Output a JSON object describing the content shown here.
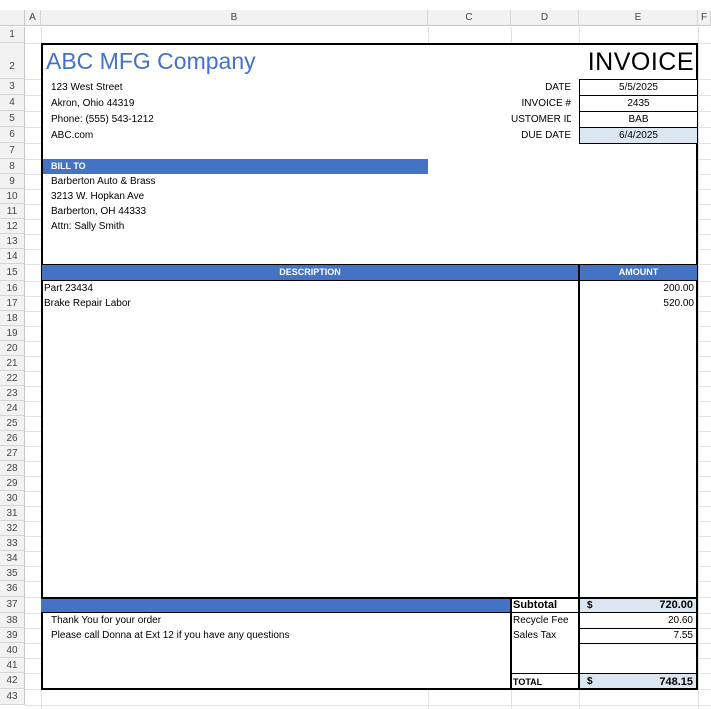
{
  "columns": [
    "A",
    "B",
    "C",
    "D",
    "E",
    "F"
  ],
  "rows": [
    "1",
    "2",
    "3",
    "4",
    "5",
    "6",
    "7",
    "8",
    "9",
    "10",
    "11",
    "12",
    "13",
    "14",
    "15",
    "16",
    "17",
    "18",
    "19",
    "20",
    "21",
    "22",
    "23",
    "24",
    "25",
    "26",
    "27",
    "28",
    "29",
    "30",
    "31",
    "32",
    "33",
    "34",
    "35",
    "36",
    "37",
    "38",
    "39",
    "40",
    "41",
    "42",
    "43"
  ],
  "company": {
    "name": "ABC MFG Company",
    "street": "123 West Street",
    "city": "Akron, Ohio 44319",
    "phone": "Phone:  (555) 543-1212",
    "web": "ABC.com"
  },
  "invoice": {
    "title": "INVOICE",
    "date_label": "DATE",
    "date": "5/5/2025",
    "number_label": "INVOICE #",
    "number": "2435",
    "customer_label": "USTOMER ID",
    "customer_id": "BAB",
    "due_label": "DUE DATE",
    "due_date": "6/4/2025"
  },
  "bill_to": {
    "header": "BILL TO",
    "name": "Barberton Auto & Brass",
    "street": "3213 W. Hopkan Ave",
    "city": "Barberton, OH 44333",
    "attn": "Attn:  Sally Smith"
  },
  "items": {
    "desc_header": "DESCRIPTION",
    "amount_header": "AMOUNT",
    "rows": [
      {
        "desc": "Part 23434",
        "amount": "200.00"
      },
      {
        "desc": "Brake Repair Labor",
        "amount": "520.00"
      }
    ]
  },
  "totals": {
    "subtotal_label": "Subtotal",
    "currency": "$",
    "subtotal": "720.00",
    "recycle_label": "Recycle Fee",
    "recycle": "20.60",
    "tax_label": "Sales Tax",
    "tax": "7.55",
    "total_label": "TOTAL",
    "total": "748.15"
  },
  "notes": {
    "thanks": "Thank You for your order",
    "contact": "Please call Donna at Ext 12 if you have any questions"
  },
  "colors": {
    "accent": "#4472c4",
    "company": "#4472c4",
    "highlight": "#dce6f1"
  }
}
